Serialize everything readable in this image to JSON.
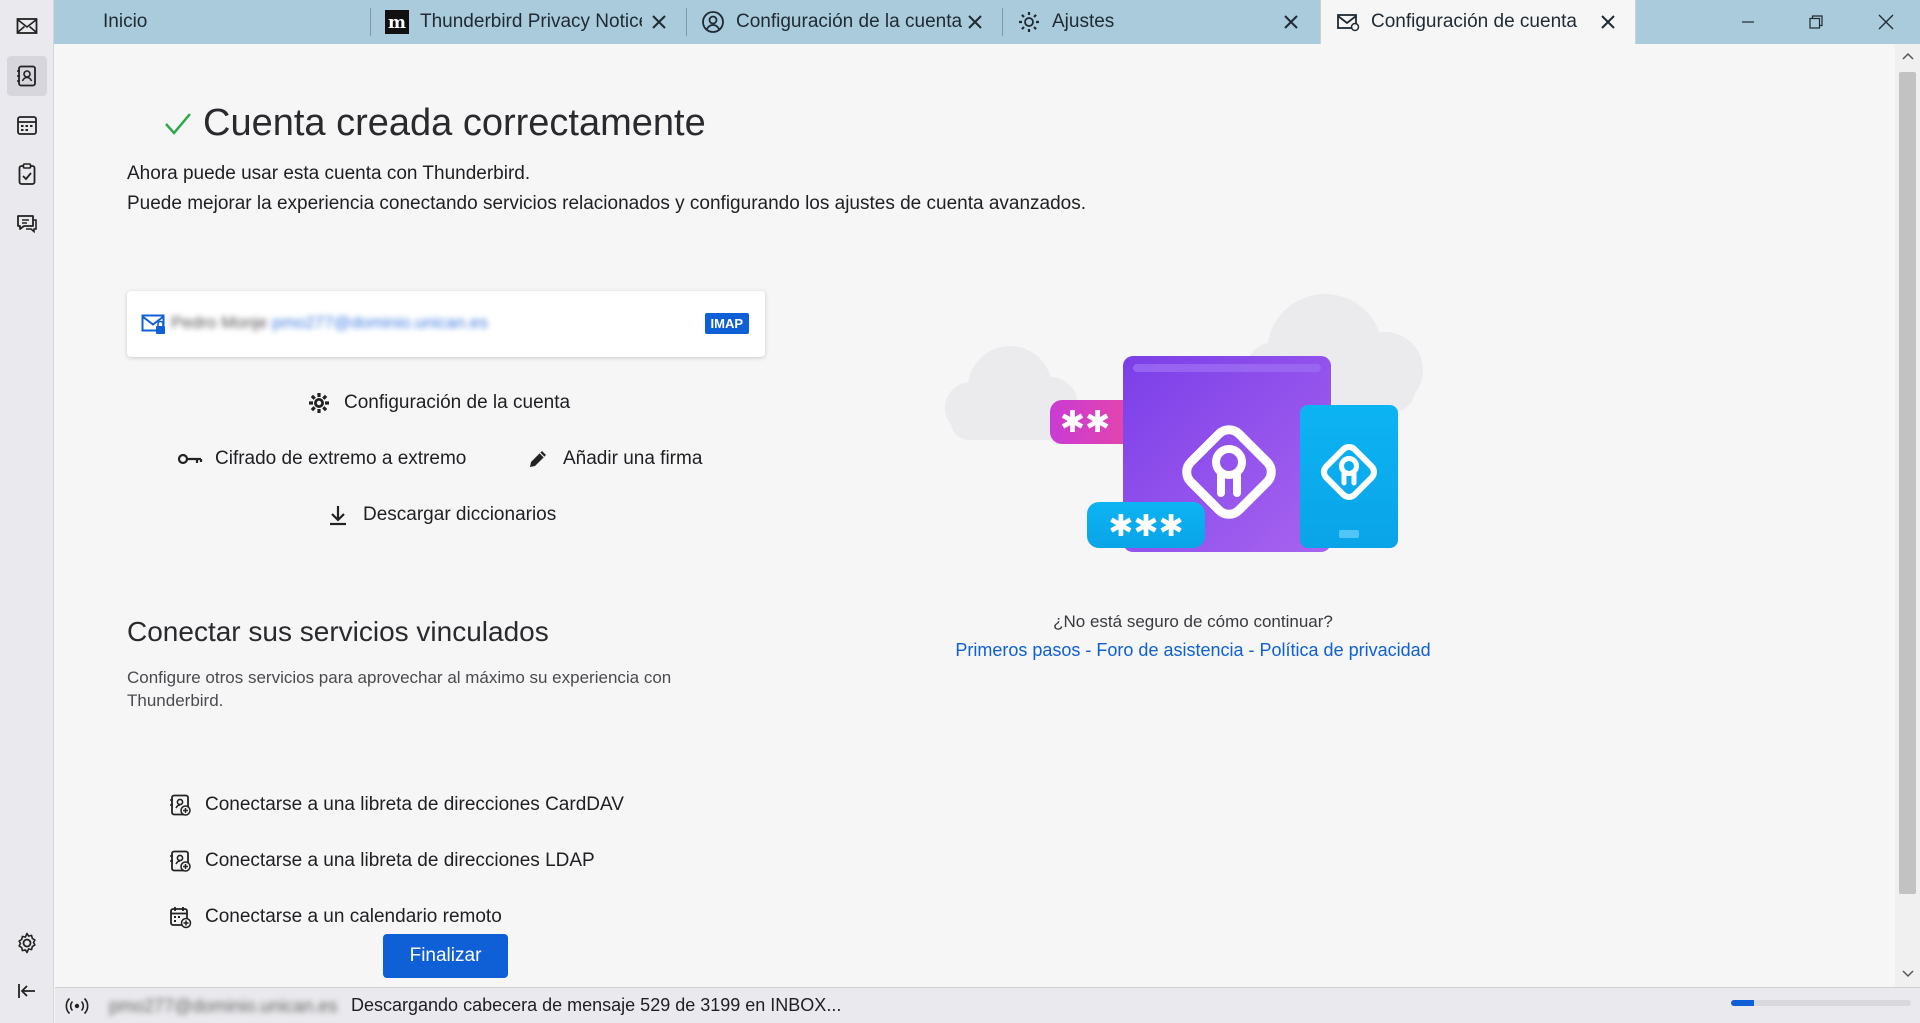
{
  "tabs": [
    {
      "label": "Inicio",
      "icon": "none",
      "closable": false
    },
    {
      "label": "Thunderbird Privacy Notice",
      "icon": "mozilla-m-icon",
      "closable": true
    },
    {
      "label": "Configuración de la cuenta",
      "icon": "account-settings-icon",
      "closable": true
    },
    {
      "label": "Ajustes",
      "icon": "gear-icon",
      "closable": true
    },
    {
      "label": "Configuración de cuenta",
      "icon": "mail-setup-icon",
      "closable": true,
      "active": true
    }
  ],
  "spaces": [
    "mail-icon",
    "address-book-icon",
    "calendar-icon",
    "tasks-icon",
    "chat-icon"
  ],
  "spaces_bottom": [
    "settings-icon",
    "collapse-icon"
  ],
  "main": {
    "title": "Cuenta creada correctamente",
    "lead_1": "Ahora puede usar esta cuenta con Thunderbird.",
    "lead_2": "Puede mejorar la experiencia conectando servicios relacionados y configurando los ajustes de cuenta avanzados.",
    "account": {
      "name": "Pedro Monje",
      "email": "pmo277@dominio.unican.es",
      "type": "IMAP"
    },
    "actions": {
      "account_settings": "Configuración de la cuenta",
      "e2e": "Cifrado de extremo a extremo",
      "signature": "Añadir una firma",
      "dictionaries": "Descargar diccionarios"
    },
    "services_title": "Conectar sus servicios vinculados",
    "services_desc": "Configure otros servicios para aprovechar al máximo su experiencia con Thunderbird.",
    "services": {
      "carddav": "Conectarse a una libreta de direcciones CardDAV",
      "ldap": "Conectarse a una libreta de direcciones LDAP",
      "calendar": "Conectarse a un calendario remoto"
    },
    "finish": "Finalizar",
    "help_question": "¿No está seguro de cómo continuar?",
    "help_links": {
      "first_steps": "Primeros pasos",
      "forum": "Foro de asistencia",
      "privacy": "Política de privacidad",
      "separator": "-"
    }
  },
  "status": {
    "account": "pmo277@dominio.unican.es",
    "text": "Descargando cabecera de mensaje 529 de 3199 en INBOX...",
    "progress_fraction": 0.13
  },
  "colors": {
    "accent": "#0f5fd6",
    "check": "#2ea84a",
    "tabbar": "#a9cbdb"
  }
}
